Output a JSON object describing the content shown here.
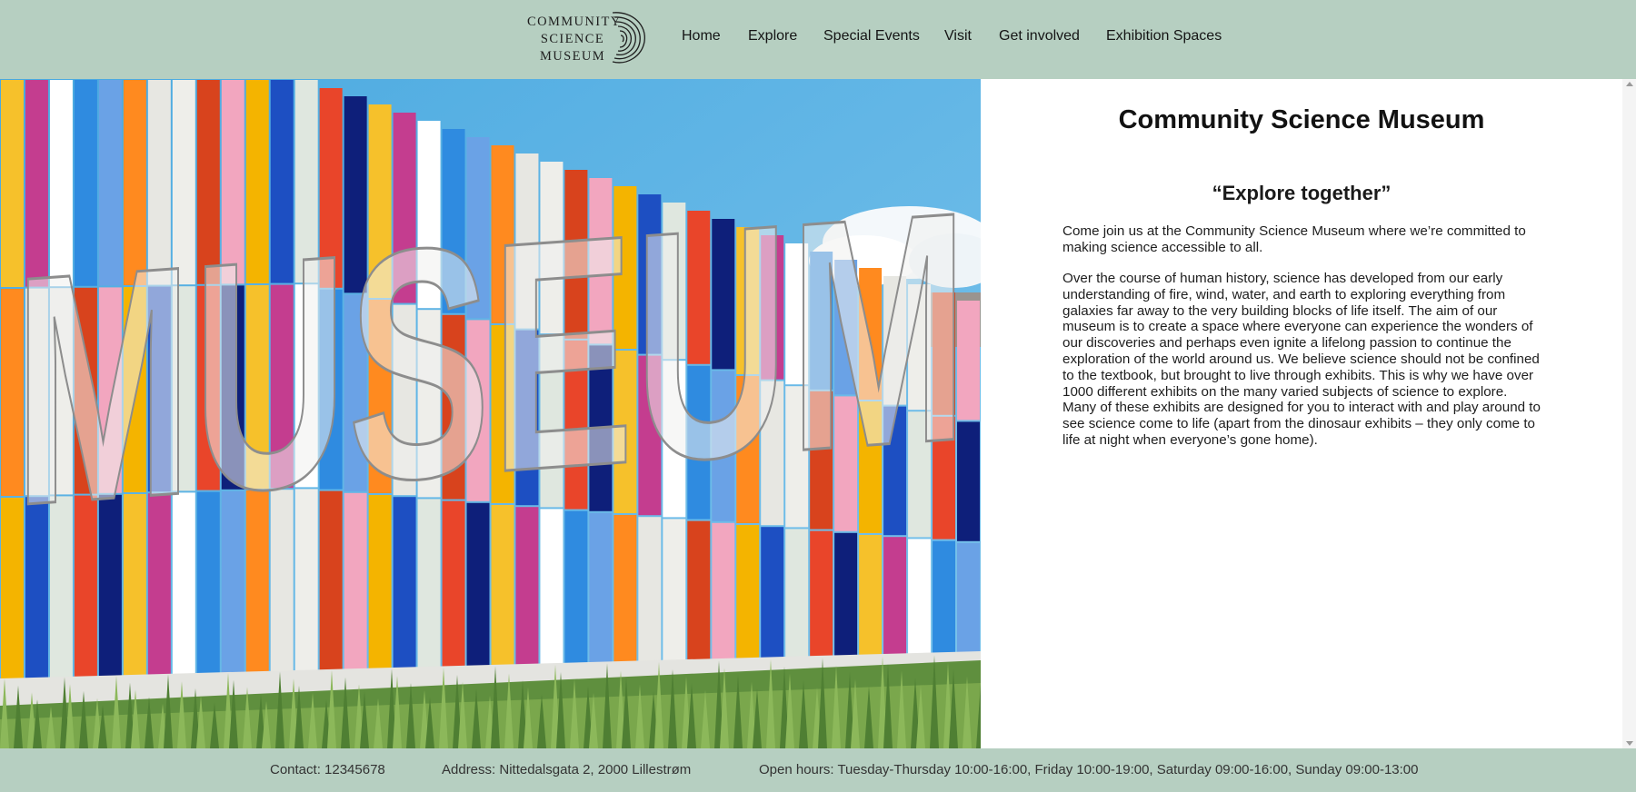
{
  "logo": {
    "line1": "COMMUNITY",
    "line2": "SCIENCE",
    "line3": "MUSEUM"
  },
  "nav": {
    "items": [
      "Home",
      "Explore",
      "Special Events",
      "Visit",
      "Get involved",
      "Exhibition Spaces"
    ]
  },
  "hero": {
    "image_subject": "Colorful glass-panel building facade with large MUSEUM letters",
    "facade_text": "MUSEUM"
  },
  "main": {
    "title": "Community Science Museum",
    "tagline": "“Explore together”",
    "paragraphs": [
      "Come join us at the Community Science Museum where we’re committed to making science accessible to all.",
      "Over the course of human history, science has developed from our early understanding of fire, wind, water, and earth to exploring everything from galaxies far away to the very building blocks of life itself. The aim of our museum is to create a space where everyone can experience the wonders of our discoveries and perhaps even ignite a lifelong passion to continue the exploration of the world around us. We believe science should not be confined to the textbook, but brought to live through exhibits. This is why we have over 1000 different exhibits on the many varied subjects of science to explore. Many of these exhibits are designed for you to interact with and play around to see science come to life (apart from the dinosaur exhibits – they only come to life at night when everyone’s gone home)."
    ]
  },
  "footer": {
    "contact": "Contact: 12345678",
    "address": "Address: Nittedalsgata 2, 2000 Lillestrøm",
    "hours": "Open hours: Tuesday-Thursday 10:00-16:00, Friday 10:00-19:00, Saturday 09:00-16:00, Sunday 09:00-13:00"
  },
  "colors": {
    "header_bg": "#b6cfc1",
    "footer_bg": "#b6cfc1",
    "text": "#1c1c1c"
  }
}
